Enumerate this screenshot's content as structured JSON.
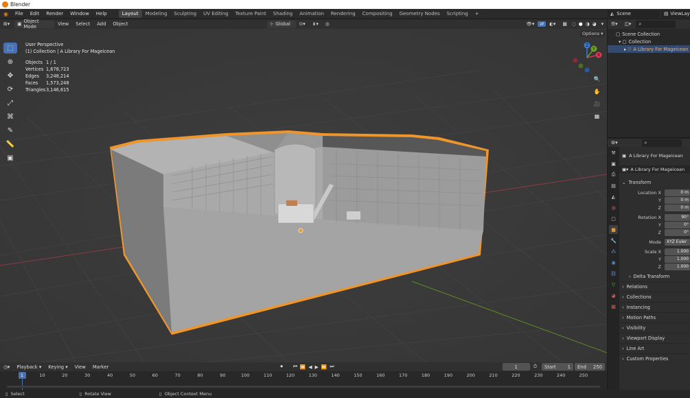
{
  "window": {
    "title": "Blender"
  },
  "menubar": {
    "items": [
      "File",
      "Edit",
      "Render",
      "Window",
      "Help"
    ]
  },
  "workspaces": {
    "tabs": [
      "Layout",
      "Modeling",
      "Sculpting",
      "UV Editing",
      "Texture Paint",
      "Shading",
      "Animation",
      "Rendering",
      "Compositing",
      "Geometry Nodes",
      "Scripting"
    ],
    "active": "Layout",
    "add": "+"
  },
  "scene": {
    "label": "Scene",
    "view_layer": "ViewLay"
  },
  "viewport_header": {
    "mode": "Object Mode",
    "menus": [
      "View",
      "Select",
      "Add",
      "Object"
    ],
    "orientation": "Global",
    "options": "Options"
  },
  "stats": {
    "perspective": "User Perspective",
    "collection": "(1) Collection | A Library For Mageicean",
    "rows": [
      {
        "label": "Objects",
        "value": "1 / 1"
      },
      {
        "label": "Vertices",
        "value": "1,678,723"
      },
      {
        "label": "Edges",
        "value": "3,248,214"
      },
      {
        "label": "Faces",
        "value": "1,573,248"
      },
      {
        "label": "Triangles",
        "value": "3,146,615"
      }
    ]
  },
  "gizmo": {
    "x": "X",
    "y": "Y",
    "z": "Z"
  },
  "outliner": {
    "items": [
      {
        "label": "Scene Collection",
        "indent": 0,
        "selected": false
      },
      {
        "label": "Collection",
        "indent": 1,
        "selected": false
      },
      {
        "label": "A Library For Mageicean",
        "indent": 2,
        "selected": true
      }
    ]
  },
  "properties": {
    "object_name": "A Library For Mageicean",
    "data_name": "A Library For Mageicean",
    "transform_title": "Transform",
    "location": {
      "label": "Location X",
      "x": "0 m",
      "y": "0 m",
      "z": "0 m"
    },
    "rotation": {
      "label": "Rotation X",
      "x": "90°",
      "y": "0°",
      "z": "0°"
    },
    "mode": {
      "label": "Mode",
      "value": "XYZ Euler"
    },
    "scale": {
      "label": "Scale X",
      "x": "1.000",
      "y": "1.000",
      "z": "1.000"
    },
    "axis_labels": {
      "y": "Y",
      "z": "Z"
    },
    "delta_transform": "Delta Transform",
    "sections": [
      "Relations",
      "Collections",
      "Instancing",
      "Motion Paths",
      "Visibility",
      "Viewport Display",
      "Line Art",
      "Custom Properties"
    ]
  },
  "timeline": {
    "menus": [
      "Playback",
      "Keying",
      "View",
      "Marker"
    ],
    "current_frame": "1",
    "start_label": "Start",
    "start": "1",
    "end_label": "End",
    "end": "250",
    "ticks": [
      "1",
      "10",
      "20",
      "30",
      "40",
      "50",
      "60",
      "70",
      "80",
      "90",
      "100",
      "110",
      "120",
      "130",
      "140",
      "150",
      "160",
      "170",
      "180",
      "190",
      "200",
      "210",
      "220",
      "230",
      "240",
      "250"
    ]
  },
  "statusbar": {
    "select": "Select",
    "rotate": "Rotate View",
    "context": "Object Context Menu"
  },
  "colors": {
    "accent": "#4772b3",
    "selection_outline": "#f0952a",
    "x_axis": "#9b3a48",
    "y_axis": "#6a8f2a"
  }
}
